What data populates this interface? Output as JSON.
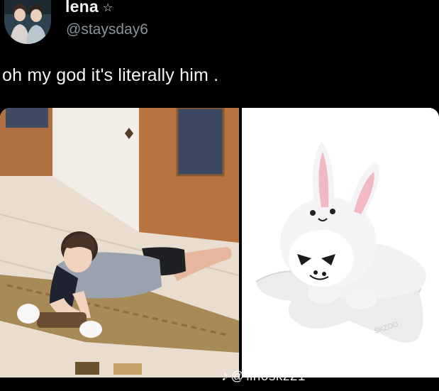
{
  "tweet": {
    "display_name": "lena",
    "name_decoration": "☆",
    "handle": "@staysday6",
    "text": "oh my god it's literally him ."
  },
  "media": {
    "watermark_text": "linoskz21",
    "watermark_icon": "tiktok-icon"
  },
  "colors": {
    "background": "#000000",
    "text": "#f5f5f5",
    "handle": "#8b9298"
  }
}
